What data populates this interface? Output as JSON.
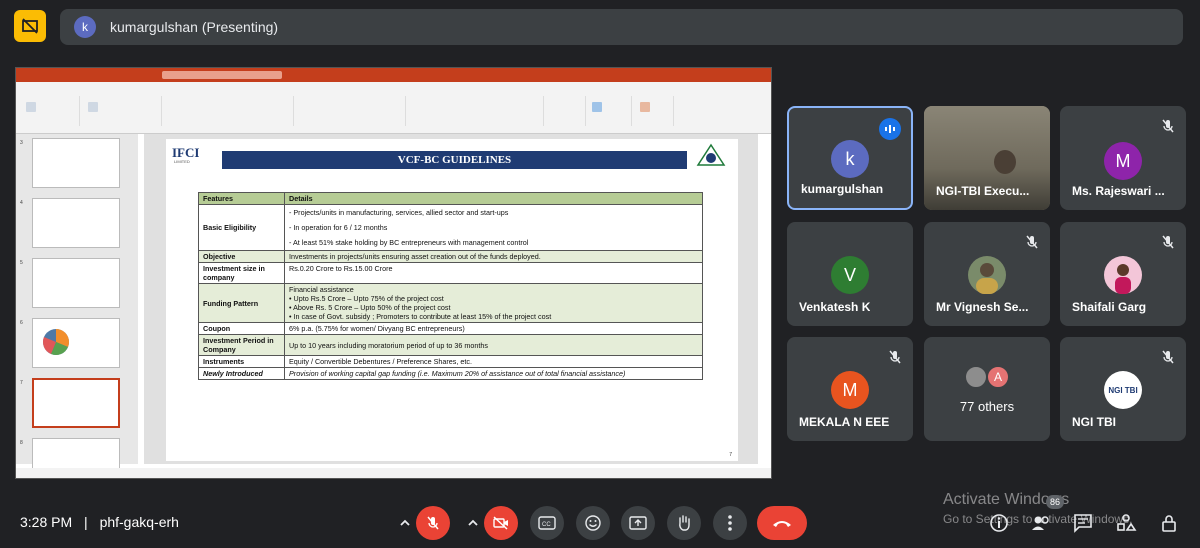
{
  "presenter": {
    "initial": "k",
    "label": "kumargulshan (Presenting)"
  },
  "slide": {
    "logo_left": "IFCI",
    "logo_left_sub": "LIMITED",
    "banner": "VCF-BC GUIDELINES",
    "page_number": "7",
    "table": {
      "headers": [
        "Features",
        "Details"
      ],
      "rows": [
        {
          "feature": "Basic Eligibility",
          "lines": [
            "-      Projects/units in manufacturing, services, allied sector and start-ups",
            "-      In operation for 6 / 12 months",
            "-      At least 51% stake holding by BC entrepreneurs with management control"
          ]
        },
        {
          "feature": "Objective",
          "lines": [
            "Investments in projects/units ensuring asset creation out of the funds deployed."
          ]
        },
        {
          "feature": "Investment size in company",
          "lines": [
            "Rs.0.20 Crore to Rs.15.00 Crore"
          ]
        },
        {
          "feature": "Funding Pattern",
          "lines": [
            "Financial assistance",
            "• Upto Rs.5 Crore – Upto 75% of the project cost",
            "• Above Rs. 5 Crore – Upto 50% of the project cost",
            "• In case of Govt. subsidy ; Promoters to contribute at least 15% of the project cost"
          ]
        },
        {
          "feature": "Coupon",
          "lines": [
            "6% p.a. (5.75% for women/ Divyang BC entrepreneurs)"
          ]
        },
        {
          "feature": "Investment Period in Company",
          "lines": [
            "Up to 10 years including moratorium period of up to 36 months"
          ]
        },
        {
          "feature": "Instruments",
          "lines": [
            "Equity  /  Convertible Debentures / Preference Shares, etc."
          ]
        },
        {
          "feature": "Newly Introduced",
          "lines": [
            "Provision of working capital gap funding (i.e. Maximum 20% of assistance out of total financial assistance)"
          ]
        }
      ]
    }
  },
  "thumbnails": [
    "3",
    "4",
    "5",
    "6",
    "7",
    "8"
  ],
  "participants": [
    {
      "name": "kumargulshan",
      "initial": "k",
      "color": "#5c6bc0"
    },
    {
      "name": "NGI-TBI Execu...",
      "initial": "",
      "color": "#6b6b5e"
    },
    {
      "name": "Ms. Rajeswari ...",
      "initial": "M",
      "color": "#8e24aa"
    },
    {
      "name": "Venkatesh K",
      "initial": "V",
      "color": "#2e7d32"
    },
    {
      "name": "Mr Vignesh Se...",
      "initial": "",
      "color": "#7a8b6a"
    },
    {
      "name": "Shaifali Garg",
      "initial": "",
      "color": "#c2668f"
    },
    {
      "name": "MEKALA N EEE",
      "initial": "M",
      "color": "#e8541f"
    },
    {
      "name": "77 others",
      "initial": "A",
      "color": "#e57373"
    },
    {
      "name": "NGI TBI",
      "initial": "NGI TBI",
      "color": "#ffffff"
    }
  ],
  "bottom": {
    "time": "3:28 PM",
    "separator": "|",
    "meeting_code": "phf-gakq-erh",
    "participant_count": "86"
  },
  "watermark": {
    "line1": "Activate Windows",
    "line2": "Go to Settings to activate Windows."
  }
}
